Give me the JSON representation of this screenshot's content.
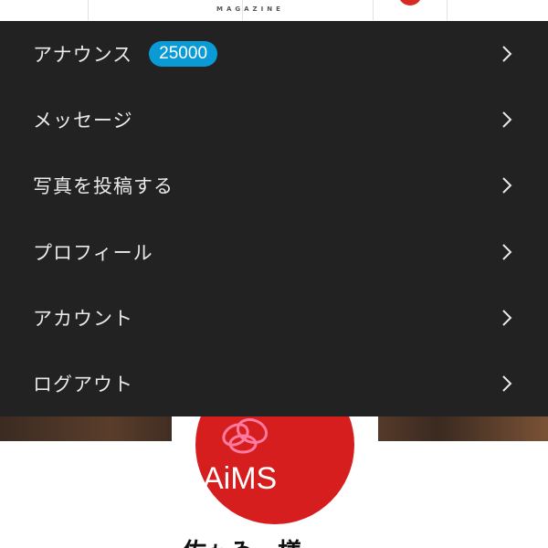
{
  "header": {
    "logo_text": "MAGAZINE",
    "logo_icon": "red-circle-logo-icon"
  },
  "menu": {
    "items": [
      {
        "label": "アナウンス",
        "badge": "25000",
        "icon": "chevron-right-icon"
      },
      {
        "label": "メッセージ",
        "icon": "chevron-right-icon"
      },
      {
        "label": "写真を投稿する",
        "icon": "chevron-right-icon"
      },
      {
        "label": "プロフィール",
        "icon": "chevron-right-icon"
      },
      {
        "label": "アカウント",
        "icon": "chevron-right-icon"
      },
      {
        "label": "ログアウト",
        "icon": "chevron-right-icon"
      }
    ]
  },
  "profile": {
    "avatar_text": "AiMS",
    "avatar_icon": "flower-logo-icon",
    "name": "佐ゎゐ一様"
  },
  "colors": {
    "menu_bg": "#222222",
    "menu_text": "#e9e9e9",
    "badge_bg": "#0a9bd6",
    "avatar_red": "#d71e1e"
  }
}
